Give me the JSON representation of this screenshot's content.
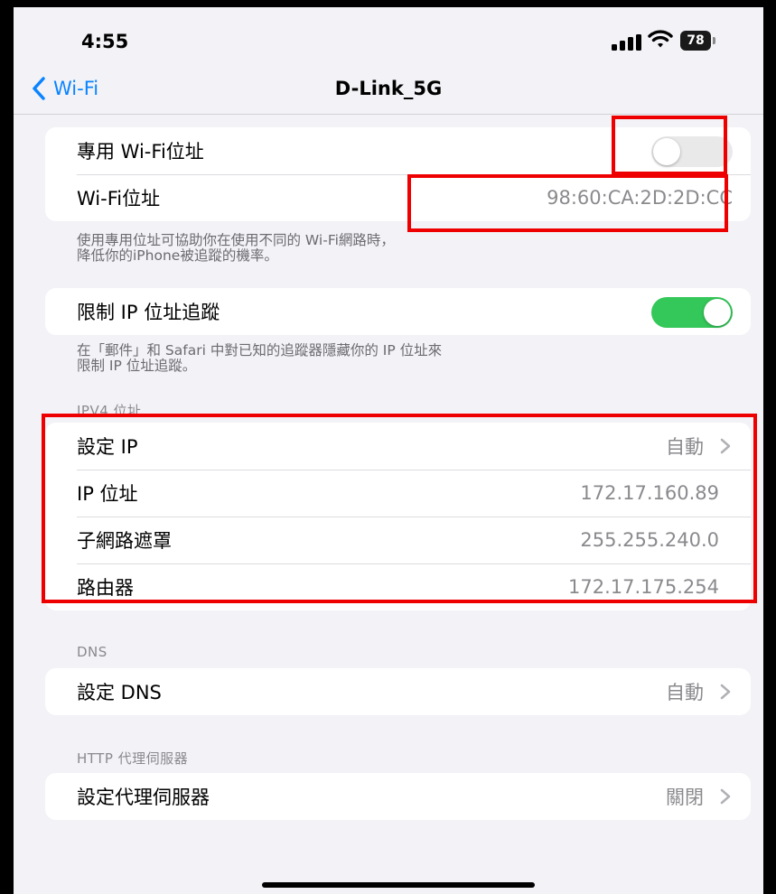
{
  "status": {
    "time": "4:55",
    "battery": "78"
  },
  "nav": {
    "back_label": "Wi-Fi",
    "title": "D-Link_5G"
  },
  "private": {
    "toggle_label": "專用 Wi-Fi位址",
    "toggle_on": false,
    "address_label": "Wi-Fi位址",
    "address_value": "98:60:CA:2D:2D:CC",
    "note_line1": "使用專用位址可協助你在使用不同的 Wi-Fi網路時，",
    "note_line2": "降低你的iPhone被追蹤的機率。"
  },
  "limit": {
    "label": "限制 IP 位址追蹤",
    "toggle_on": true,
    "note_line1": "在「郵件」和 Safari 中對已知的追蹤器隱藏你的 IP 位址來",
    "note_line2": "限制 IP 位址追蹤。"
  },
  "ipv4": {
    "header": "IPV4 位址",
    "rows": [
      {
        "label": "設定 IP",
        "value": "自動"
      },
      {
        "label": "IP 位址",
        "value": "172.17.160.89"
      },
      {
        "label": "子網路遮罩",
        "value": "255.255.240.0"
      },
      {
        "label": "路由器",
        "value": "172.17.175.254"
      }
    ]
  },
  "dns": {
    "header": "DNS",
    "label": "設定 DNS",
    "value": "自動"
  },
  "proxy": {
    "header": "HTTP 代理伺服器",
    "label": "設定代理伺服器",
    "value": "關閉"
  },
  "colors": {
    "accent": "#0a84ff",
    "toggle_on": "#34c759",
    "highlight": "#ee0000"
  }
}
